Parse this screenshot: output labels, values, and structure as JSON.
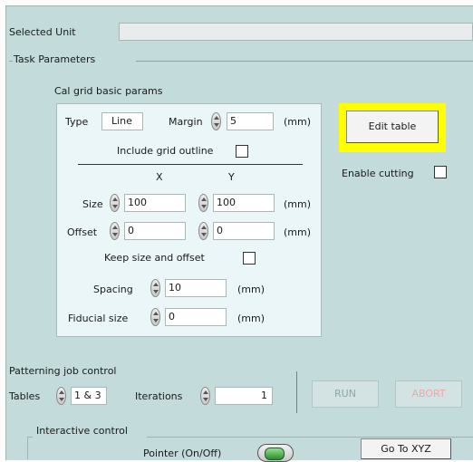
{
  "selected_unit": {
    "label": "Selected Unit",
    "value": ""
  },
  "task_parameters": {
    "label": "Task Parameters"
  },
  "cal_grid": {
    "title": "Cal grid basic params",
    "type_label": "Type",
    "type_value": "Line",
    "margin_label": "Margin",
    "margin_value": "5",
    "margin_unit": "(mm)",
    "include_outline_label": "Include grid outline",
    "col_x": "X",
    "col_y": "Y",
    "size_label": "Size",
    "size_x": "100",
    "size_y": "100",
    "size_unit": "(mm)",
    "offset_label": "Offset",
    "offset_x": "0",
    "offset_y": "0",
    "offset_unit": "(mm)",
    "keep_label": "Keep size and offset",
    "spacing_label": "Spacing",
    "spacing_value": "10",
    "spacing_unit": "(mm)",
    "fiducial_label": "Fiducial size",
    "fiducial_value": "0",
    "fiducial_unit": "(mm)"
  },
  "edit_table": {
    "label": "Edit table",
    "highlight_color": "#ffff00"
  },
  "enable_cutting": {
    "label": "Enable cutting"
  },
  "patterning": {
    "title": "Patterning job control",
    "tables_label": "Tables",
    "tables_value": "1 & 3",
    "iterations_label": "Iterations",
    "iterations_value": "1",
    "run_label": "RUN",
    "abort_label": "ABORT"
  },
  "interactive": {
    "title": "Interactive control",
    "pointer_label": "Pointer (On/Off)",
    "goto_label": "Go To XYZ"
  },
  "colors": {
    "panel_bg": "#c3dbdb",
    "box_bg": "#eaf6f7",
    "highlight": "#ffff00"
  }
}
